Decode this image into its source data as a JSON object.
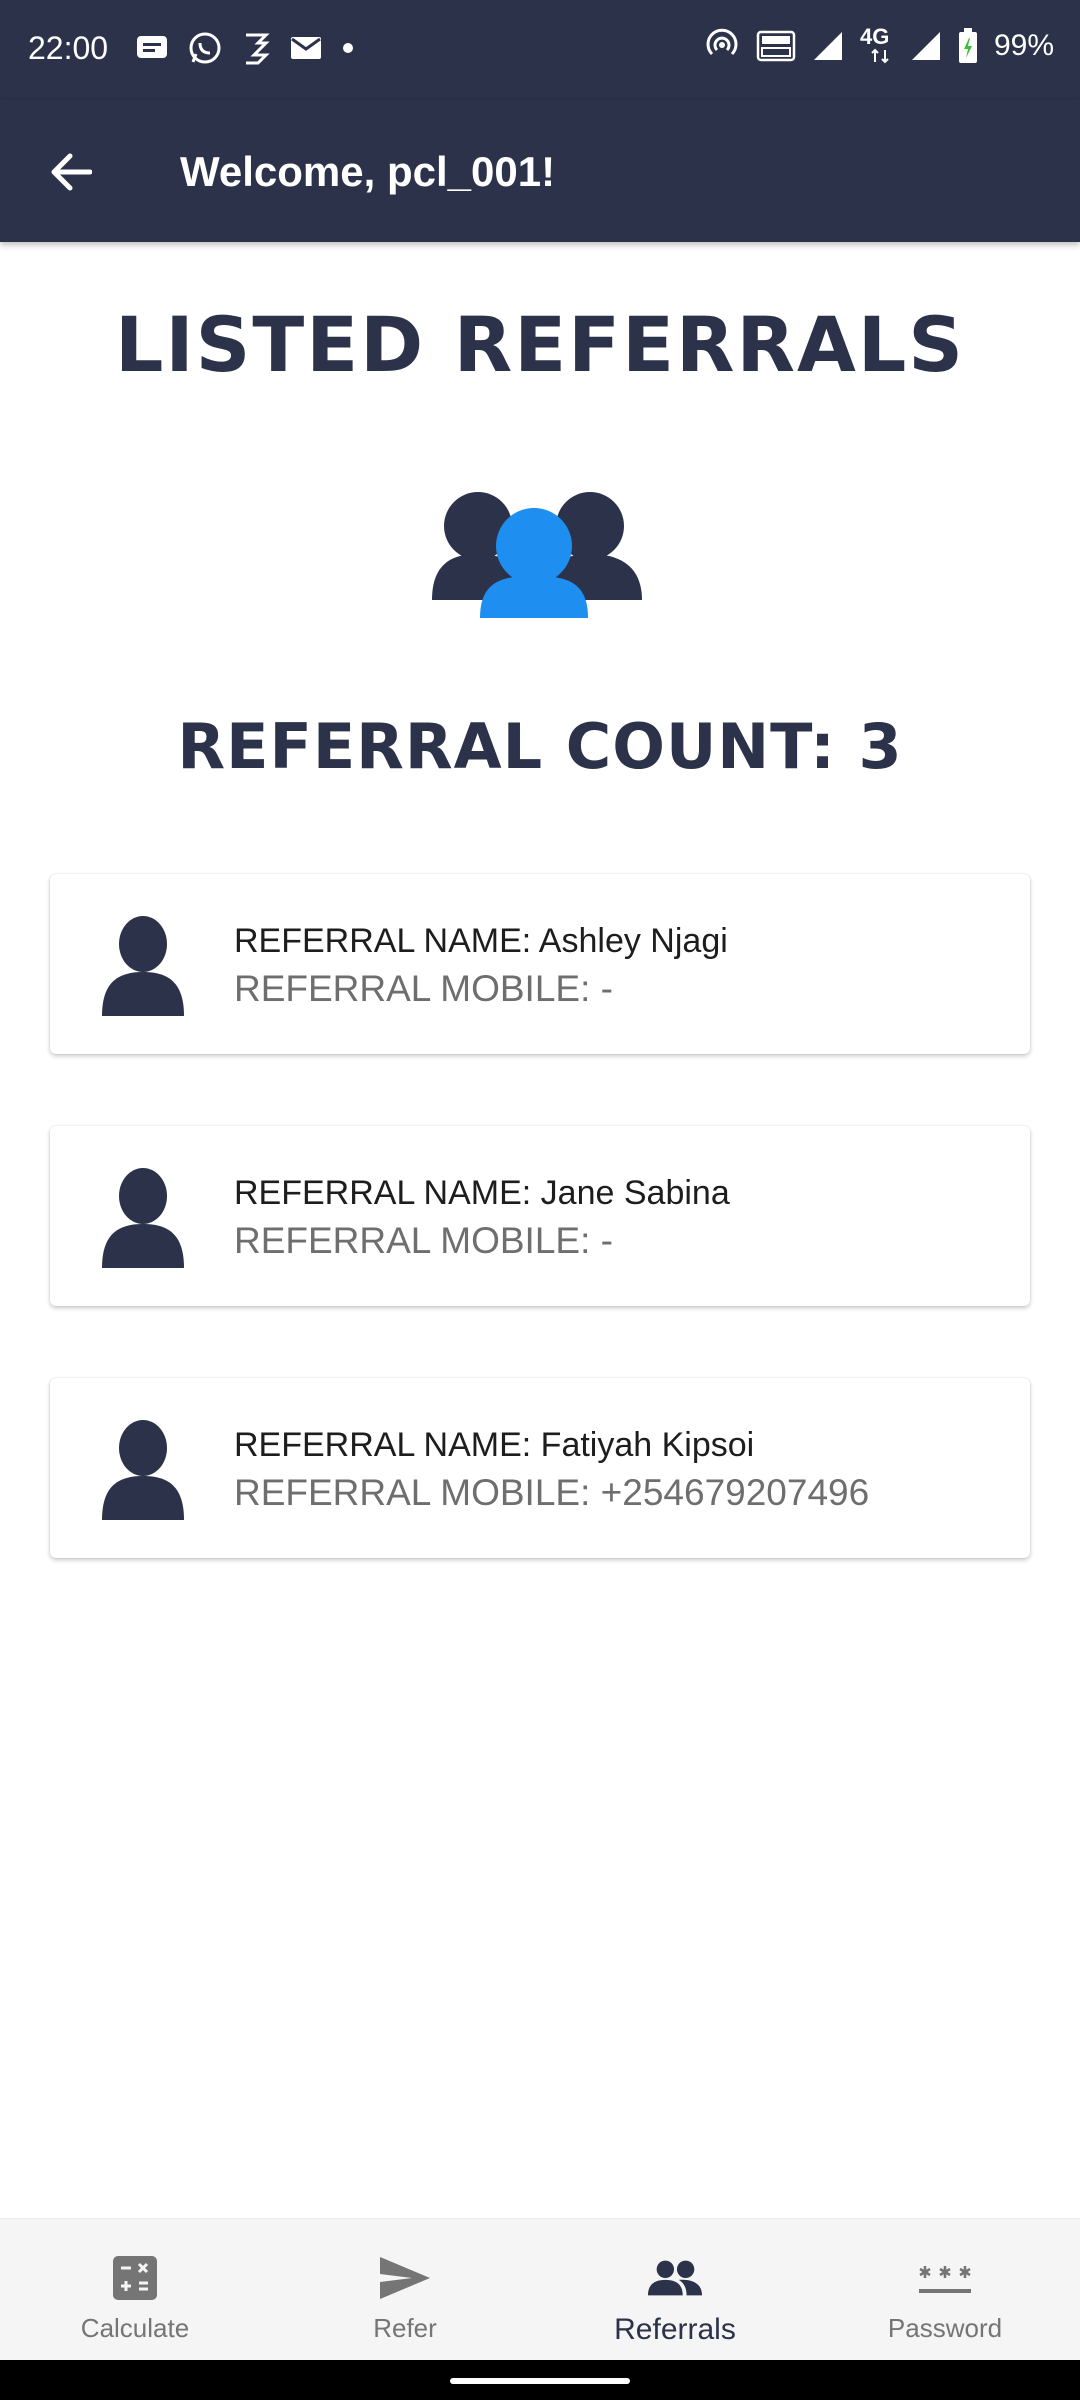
{
  "status_bar": {
    "time": "22:00",
    "battery": "99%",
    "network": "4G",
    "icons_left": [
      "message-icon",
      "whatsapp-icon",
      "sim-icon",
      "email-icon",
      "dot-icon"
    ],
    "icons_right": [
      "hotspot-icon",
      "volte-icon",
      "signal-icon",
      "signal-icon",
      "battery-icon"
    ]
  },
  "app_bar": {
    "title": "Welcome, pcl_001!",
    "back_icon": "arrow-left-icon"
  },
  "main": {
    "title": "LISTED REFERRALS",
    "count_label": "REFERRAL COUNT:",
    "count": "3",
    "referrals": [
      {
        "name_line": "REFERRAL NAME: Ashley Njagi",
        "mobile_line": "REFERRAL MOBILE: -"
      },
      {
        "name_line": "REFERRAL NAME: Jane Sabina",
        "mobile_line": "REFERRAL MOBILE: -"
      },
      {
        "name_line": "REFERRAL NAME: Fatiyah Kipsoi",
        "mobile_line": "REFERRAL MOBILE: +254679207496"
      }
    ]
  },
  "bottom_nav": {
    "items": [
      {
        "label": "Calculate",
        "icon": "calculator-icon",
        "active": false
      },
      {
        "label": "Refer",
        "icon": "send-icon",
        "active": false
      },
      {
        "label": "Referrals",
        "icon": "people-icon",
        "active": true
      },
      {
        "label": "Password",
        "icon": "password-icon",
        "active": false
      }
    ]
  },
  "colors": {
    "primary_dark": "#2b3249",
    "accent_blue": "#1e8ff0",
    "inactive_gray": "#757575"
  }
}
